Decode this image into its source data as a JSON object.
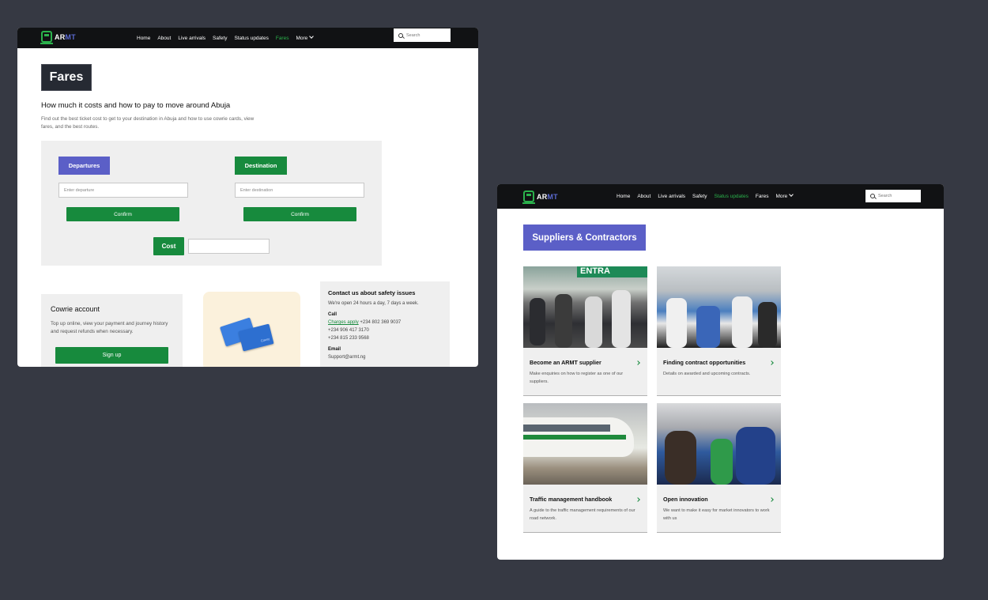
{
  "brand": {
    "logo_a": "AR",
    "logo_m": "MT",
    "green": "#178a3d",
    "purple": "#5b5fc7",
    "dark": "#111214"
  },
  "nav": {
    "links": [
      "Home",
      "About",
      "Live arrivals",
      "Safety",
      "Status updates",
      "Fares",
      "More"
    ],
    "search_placeholder": "Search"
  },
  "fares_page": {
    "active_nav": "Fares",
    "title": "Fares",
    "subheading": "How much it costs and how to pay to move around Abuja",
    "lead": "Find out the best ticket cost to get to your destination in Abuja and how to use cowrie cards, view fares, and the best routes.",
    "departures_label": "Departures",
    "departure_placeholder": "Enter departure",
    "destination_label": "Destination",
    "destination_placeholder": "Enter destination",
    "confirm_label": "Confirm",
    "cost_label": "Cost",
    "cost_value": "",
    "cowrie": {
      "heading": "Cowrie account",
      "body": "Top up online, view your payment and journey history and request refunds when necessary.",
      "signup": "Sign up",
      "card_brand": "Cowry"
    },
    "contact": {
      "heading": "Contact us about safety issues",
      "hours": "We're open 24 hours a day, 7 days a week.",
      "call_label": "Call",
      "charges_link": "Charges apply",
      "phones": [
        "+234 802 369 9037",
        "+234 906 417 3170",
        "+234 815 233 9568"
      ],
      "email_label": "Email",
      "email": "Support@armt.ng"
    }
  },
  "suppliers_page": {
    "active_nav": "Status updates",
    "title": "Suppliers & Contractors",
    "cards": [
      {
        "title": "Become an ARMT supplier",
        "desc": "Make enquiries on how to register as one of our suppliers."
      },
      {
        "title": "Finding contract opportunities",
        "desc": "Details on awarded and upcoming contracts."
      },
      {
        "title": "Traffic management handbook",
        "desc": "A guide to the traffic management requirements of our road network."
      },
      {
        "title": "Open innovation",
        "desc": "We want to make it easy for market innovators to work with us"
      }
    ],
    "photo_sign": "ENTRA"
  }
}
